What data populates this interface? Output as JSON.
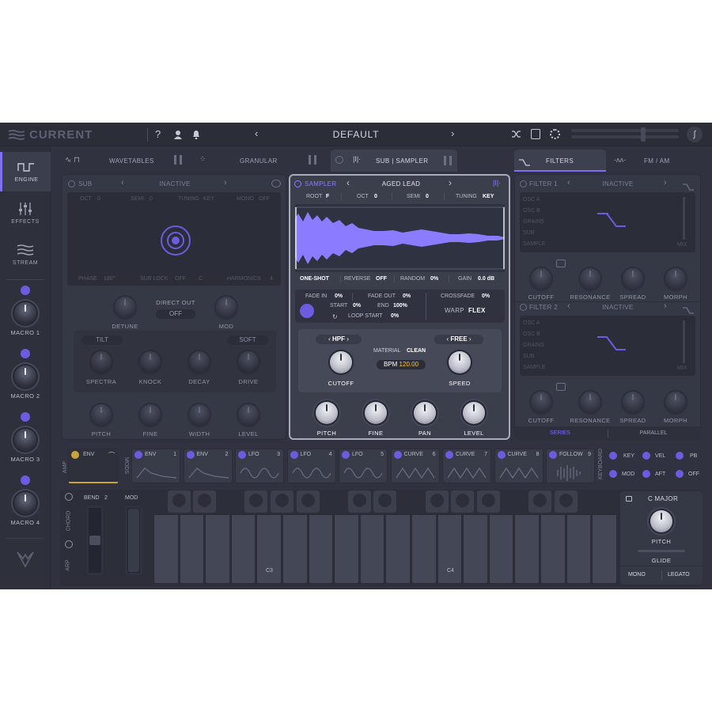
{
  "header": {
    "app_name": "CURRENT",
    "preset": "DEFAULT"
  },
  "sidebar": {
    "items": [
      {
        "label": "ENGINE"
      },
      {
        "label": "EFFECTS"
      },
      {
        "label": "STREAM"
      }
    ],
    "macros": [
      {
        "label": "MACRO 1"
      },
      {
        "label": "MACRO 2"
      },
      {
        "label": "MACRO 3"
      },
      {
        "label": "MACRO 4"
      }
    ]
  },
  "tabs": {
    "wavetables": "WAVETABLES",
    "granular": "GRANULAR",
    "sub_sampler": "SUB | SAMPLER",
    "filters": "FILTERS",
    "fm_am": "FM / AM"
  },
  "sub": {
    "title": "SUB",
    "state": "INACTIVE",
    "oct": "OCT",
    "oct_val": "0",
    "semi": "SEMI",
    "semi_val": "0",
    "tuning": "TUNING",
    "tuning_val": "KEY",
    "mono": "MONO",
    "mono_val": "OFF",
    "phase": "PHASE",
    "phase_val": "180°",
    "sub_lock": "SUB LOCK",
    "sub_lock_val": "OFF",
    "sub_lock_note": "C",
    "harmonics": "HARMONICS",
    "harmonics_val": "4",
    "direct_out": "DIRECT OUT",
    "direct_out_val": "OFF",
    "detune": "DETUNE",
    "mod": "MOD",
    "tilt": "TILT",
    "soft": "SOFT",
    "knobs1": [
      "SPECTRA",
      "KNOCK",
      "DECAY",
      "DRIVE"
    ],
    "knobs2": [
      "PITCH",
      "FINE",
      "WIDTH",
      "LEVEL"
    ]
  },
  "sampler": {
    "title": "SAMPLER",
    "preset": "AGED LEAD",
    "root": "ROOT",
    "root_val": "F",
    "oct": "OCT",
    "oct_val": "0",
    "semi": "SEMI",
    "semi_val": "0",
    "tuning": "TUNING",
    "tuning_val": "KEY",
    "one_shot": "ONE-SHOT",
    "reverse": "REVERSE",
    "reverse_val": "OFF",
    "random": "RANDOM",
    "random_val": "0%",
    "gain": "GAIN",
    "gain_val": "0.0 dB",
    "fade_in": "FADE IN",
    "fade_in_val": "0%",
    "fade_out": "FADE OUT",
    "fade_out_val": "0%",
    "crossfade": "CROSSFADE",
    "crossfade_val": "0%",
    "start": "START",
    "start_val": "0%",
    "end": "END",
    "end_val": "100%",
    "loop_start": "LOOP START",
    "loop_start_val": "0%",
    "warp": "WARP",
    "warp_val": "FLEX",
    "filter_type": "HPF",
    "material": "MATERIAL",
    "material_val": "CLEAN",
    "free": "FREE",
    "bpm": "BPM",
    "bpm_val": "120.00",
    "cutoff": "CUTOFF",
    "speed": "SPEED",
    "knobs": [
      "PITCH",
      "FINE",
      "PAN",
      "LEVEL"
    ]
  },
  "filters": [
    {
      "title": "FILTER 1",
      "state": "INACTIVE",
      "routes": [
        "OSC A",
        "OSC B",
        "GRAINS",
        "SUB",
        "SAMPLE"
      ],
      "mix": "MIX",
      "knobs": [
        "CUTOFF",
        "RESONANCE",
        "SPREAD",
        "MORPH"
      ]
    },
    {
      "title": "FILTER 2",
      "state": "INACTIVE",
      "routes": [
        "OSC A",
        "OSC B",
        "GRAINS",
        "SUB",
        "SAMPLE"
      ],
      "mix": "MIX",
      "knobs": [
        "CUTOFF",
        "RESONANCE",
        "SPREAD",
        "MORPH"
      ]
    }
  ],
  "filter_mode": {
    "series": "SERIES",
    "parallel": "PARALLEL"
  },
  "mods": {
    "amp_label": "AMP",
    "mods_label": "MODS",
    "amp_env": "ENV",
    "cells": [
      {
        "label": "ENV",
        "num": "1"
      },
      {
        "label": "ENV",
        "num": "2"
      },
      {
        "label": "LFO",
        "num": "3"
      },
      {
        "label": "LFO",
        "num": "4"
      },
      {
        "label": "LFO",
        "num": "5"
      },
      {
        "label": "CURVE",
        "num": "6"
      },
      {
        "label": "CURVE",
        "num": "7"
      },
      {
        "label": "CURVE",
        "num": "8"
      },
      {
        "label": "FOLLOW",
        "num": "9"
      }
    ],
    "keyboard_label": "KEYBOARD",
    "kb_mods": [
      "KEY",
      "VEL",
      "PB",
      "MOD",
      "AFT",
      "OFF"
    ]
  },
  "keyboard": {
    "chord": "CHORD",
    "arp": "ARP",
    "bend": "BEND",
    "bend_val": "2",
    "mod": "MOD",
    "c3": "C3",
    "c4": "C4",
    "scale": "C MAJOR",
    "pitch": "PITCH",
    "glide": "GLIDE",
    "mono": "MONO",
    "legato": "LEGATO"
  }
}
